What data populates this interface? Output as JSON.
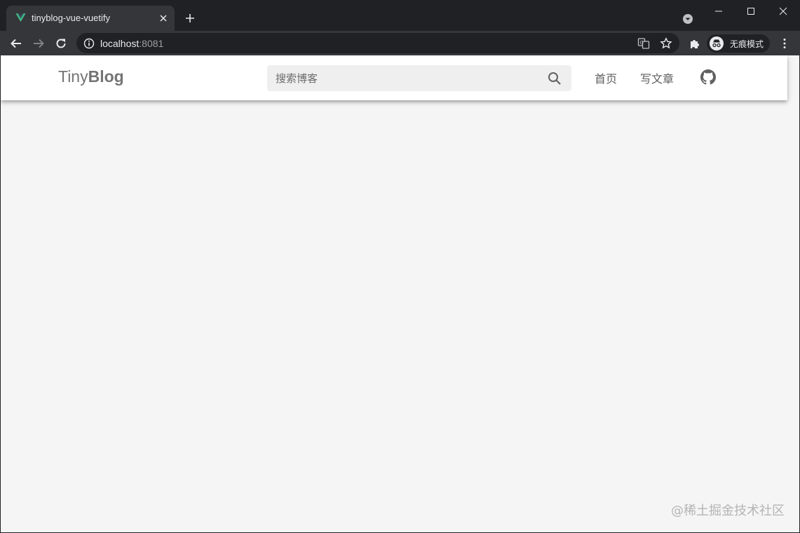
{
  "browser": {
    "tab": {
      "title": "tinyblog-vue-vuetify",
      "favicon": "vue-logo-icon"
    },
    "address": {
      "host": "localhost",
      "port": ":8081"
    },
    "profile_label": "无痕模式",
    "icons": {
      "back": "arrow-left-icon",
      "forward": "arrow-right-icon",
      "reload": "reload-icon",
      "info": "info-icon",
      "translate": "translate-icon",
      "bookmark": "star-icon",
      "extensions": "puzzle-icon",
      "menu": "kebab-menu-icon"
    }
  },
  "page": {
    "brand": {
      "light": "Tiny",
      "bold": "Blog"
    },
    "search": {
      "placeholder": "搜索博客"
    },
    "nav": {
      "home": "首页",
      "write": "写文章"
    },
    "watermark": "@稀土掘金技术社区"
  },
  "colors": {
    "chrome_dark": "#202124",
    "chrome_toolbar": "#35363a",
    "vue_green": "#41b883",
    "page_bg": "#f5f5f5",
    "appbar_bg": "#ffffff",
    "text_muted": "#757575"
  }
}
